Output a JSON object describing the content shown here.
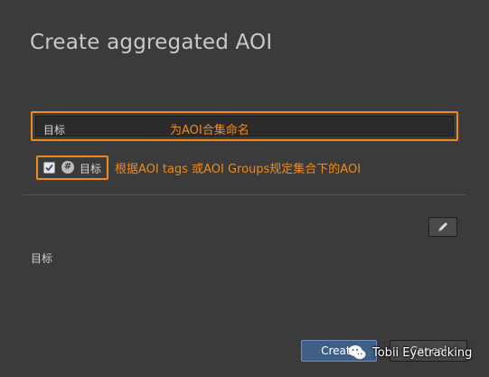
{
  "dialog": {
    "title": "Create aggregated AOI"
  },
  "name_field": {
    "value": "目标",
    "annotation": "为AOI合集命名"
  },
  "tag_filter": {
    "checked": true,
    "icon": "hash-icon",
    "label": "目标",
    "annotation": "根据AOI tags 或AOI Groups规定集合下的AOI"
  },
  "tag_list": {
    "items": [
      "目标"
    ]
  },
  "buttons": {
    "create_label": "Create",
    "cancel_label": "Cancel"
  },
  "watermark": {
    "text": "Tobii Eyetracking"
  },
  "colors": {
    "accent_annotation": "#f08a1c",
    "primary_button": "#3f5f86",
    "background": "#3b3b3b"
  }
}
